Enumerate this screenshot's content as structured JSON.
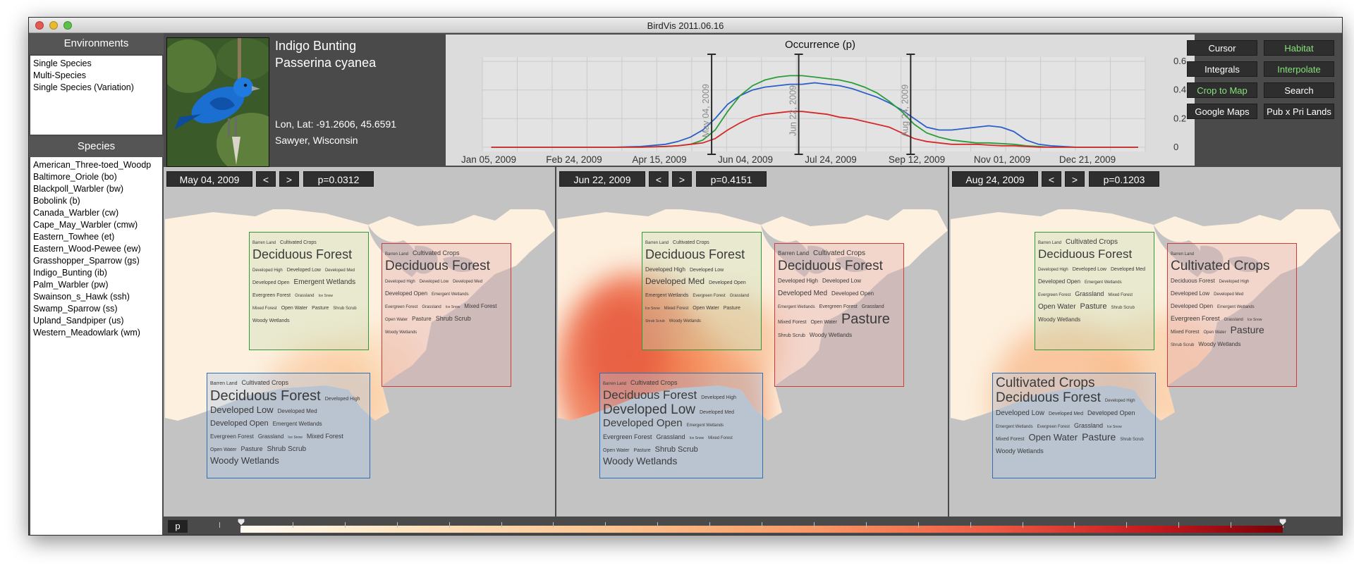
{
  "window": {
    "title": "BirdVis   2011.06.16"
  },
  "environments": {
    "header": "Environments",
    "items": [
      "Single Species",
      "Multi-Species",
      "Single Species (Variation)"
    ]
  },
  "species": {
    "header": "Species",
    "items": [
      "American_Three-toed_Woodp",
      "Baltimore_Oriole (bo)",
      "Blackpoll_Warbler (bw)",
      "Bobolink (b)",
      "Canada_Warbler (cw)",
      "Cape_May_Warbler (cmw)",
      "Eastern_Towhee (et)",
      "Eastern_Wood-Pewee (ew)",
      "Grasshopper_Sparrow (gs)",
      "Indigo_Bunting (ib)",
      "Palm_Warbler (pw)",
      "Swainson_s_Hawk (ssh)",
      "Swamp_Sparrow (ss)",
      "Upland_Sandpiper (us)",
      "Western_Meadowlark (wm)"
    ]
  },
  "bird": {
    "common_name": "Indigo Bunting",
    "latin_name": "Passerina cyanea",
    "lonlat": "Lon, Lat: -91.2606, 45.6591",
    "location": "Sawyer, Wisconsin"
  },
  "chart_data": {
    "type": "line",
    "title": "Occurrence (p)",
    "x_tick_labels": [
      "Jan 05, 2009",
      "Feb 24, 2009",
      "Apr 15, 2009",
      "Jun 04, 2009",
      "Jul 24, 2009",
      "Sep 12, 2009",
      "Nov 01, 2009",
      "Dec 21, 2009"
    ],
    "y_ticks": [
      0,
      0.2,
      0.4,
      0.6
    ],
    "y_tick_labels": [
      "0",
      "0.2",
      "0.4",
      "0.6"
    ],
    "ylim": [
      -0.03,
      0.63
    ],
    "x_day_range": [
      -5,
      368
    ],
    "x": [
      0,
      14,
      28,
      42,
      56,
      70,
      84,
      98,
      105,
      112,
      119,
      126,
      133,
      140,
      147,
      154,
      161,
      168,
      175,
      182,
      189,
      196,
      203,
      210,
      217,
      224,
      231,
      238,
      245,
      252,
      259,
      266,
      273,
      280,
      287,
      294,
      301,
      308,
      315,
      322,
      329,
      336,
      350,
      364
    ],
    "series": [
      {
        "color": "#2b5fc7",
        "values": [
          0,
          0,
          0,
          0,
          0,
          0,
          0.005,
          0.02,
          0.04,
          0.07,
          0.12,
          0.2,
          0.3,
          0.36,
          0.4,
          0.42,
          0.43,
          0.44,
          0.44,
          0.45,
          0.44,
          0.43,
          0.41,
          0.38,
          0.35,
          0.31,
          0.26,
          0.2,
          0.14,
          0.12,
          0.12,
          0.13,
          0.14,
          0.15,
          0.14,
          0.11,
          0.05,
          0.02,
          0.01,
          0.005,
          0,
          0,
          0,
          0
        ]
      },
      {
        "color": "#2a9d3a",
        "values": [
          0,
          0,
          0,
          0,
          0,
          0,
          0,
          0.005,
          0.01,
          0.02,
          0.05,
          0.12,
          0.25,
          0.36,
          0.43,
          0.47,
          0.49,
          0.5,
          0.5,
          0.49,
          0.48,
          0.47,
          0.45,
          0.42,
          0.38,
          0.32,
          0.25,
          0.16,
          0.1,
          0.07,
          0.05,
          0.04,
          0.03,
          0.03,
          0.025,
          0.02,
          0.01,
          0.005,
          0,
          0,
          0,
          0,
          0,
          0
        ]
      },
      {
        "color": "#d42a2a",
        "values": [
          0,
          0,
          0,
          0,
          0,
          0,
          0,
          0.005,
          0.01,
          0.02,
          0.03,
          0.06,
          0.12,
          0.17,
          0.21,
          0.23,
          0.24,
          0.25,
          0.25,
          0.24,
          0.23,
          0.21,
          0.2,
          0.18,
          0.16,
          0.14,
          0.1,
          0.06,
          0.04,
          0.03,
          0.02,
          0.02,
          0.02,
          0.015,
          0.01,
          0.01,
          0.005,
          0,
          0,
          0,
          0,
          0,
          0,
          0
        ]
      }
    ],
    "cursors": [
      {
        "label": "May 04, 2009",
        "day": 124
      },
      {
        "label": "Jun 22, 2009",
        "day": 173
      },
      {
        "label": "Aug 24, 2009",
        "day": 236
      }
    ]
  },
  "buttons": [
    {
      "label": "Cursor",
      "green": false
    },
    {
      "label": "Habitat",
      "green": true
    },
    {
      "label": "Integrals",
      "green": false
    },
    {
      "label": "Interpolate",
      "green": true
    },
    {
      "label": "Crop to Map",
      "green": true
    },
    {
      "label": "Search",
      "green": false
    },
    {
      "label": "Google Maps",
      "green": false
    },
    {
      "label": "Pub x Pri Lands",
      "green": false
    }
  ],
  "maps": [
    {
      "date": "May 04, 2009",
      "prev": "<",
      "next": ">",
      "p": "p=0.0312",
      "hotspots": [
        {
          "x": 230,
          "y": 290,
          "rx": 90,
          "ry": 100,
          "c": "#f8b37a",
          "o": 0.45
        },
        {
          "x": 300,
          "y": 230,
          "rx": 70,
          "ry": 60,
          "c": "#fbc693",
          "o": 0.35
        }
      ],
      "regions": [
        {
          "color": "green",
          "words": [
            [
              "Barren Land",
              6
            ],
            [
              "Cultivated Crops",
              7
            ],
            [
              "Deciduous Forest",
              18
            ],
            [
              "Developed High",
              6
            ],
            [
              "Developed Low",
              7
            ],
            [
              "Developed Med",
              6
            ],
            [
              "Developed Open",
              7
            ],
            [
              "Emergent Wetlands",
              10
            ],
            [
              "Evergreen Forest",
              7
            ],
            [
              "Grassland",
              6
            ],
            [
              "Ice Snow",
              5
            ],
            [
              "Mixed Forest",
              6
            ],
            [
              "Open Water",
              7
            ],
            [
              "Pasture",
              7
            ],
            [
              "Shrub Scrub",
              6
            ],
            [
              "Woody Wetlands",
              7
            ]
          ]
        },
        {
          "color": "red",
          "words": [
            [
              "Barren Land",
              6
            ],
            [
              "Cultivated Crops",
              9
            ],
            [
              "Deciduous Forest",
              19
            ],
            [
              "Developed High",
              6
            ],
            [
              "Developed Low",
              6
            ],
            [
              "Developed Med",
              6
            ],
            [
              "Developed Open",
              8
            ],
            [
              "Emergent Wetlands",
              6
            ],
            [
              "Evergreen Forest",
              6
            ],
            [
              "Grassland",
              6
            ],
            [
              "Ice Snow",
              5
            ],
            [
              "Mixed Forest",
              8
            ],
            [
              "Open Water",
              6
            ],
            [
              "Pasture",
              8
            ],
            [
              "Shrub Scrub",
              9
            ],
            [
              "Woody Wetlands",
              6
            ]
          ]
        },
        {
          "color": "blue",
          "words": [
            [
              "Barren Land",
              7
            ],
            [
              "Cultivated Crops",
              9
            ],
            [
              "Deciduous Forest",
              20
            ],
            [
              "Developed High",
              7
            ],
            [
              "Developed Low",
              13
            ],
            [
              "Developed Med",
              8
            ],
            [
              "Developed Open",
              11
            ],
            [
              "Emergent Wetlands",
              8
            ],
            [
              "Evergreen Forest",
              8
            ],
            [
              "Grassland",
              8
            ],
            [
              "Ice Snow",
              5
            ],
            [
              "Mixed Forest",
              9
            ],
            [
              "Open Water",
              7
            ],
            [
              "Pasture",
              9
            ],
            [
              "Shrub Scrub",
              10
            ],
            [
              "Woody Wetlands",
              13
            ]
          ]
        }
      ]
    },
    {
      "date": "Jun 22, 2009",
      "prev": "<",
      "next": ">",
      "p": "p=0.4151",
      "hotspots": [
        {
          "x": 110,
          "y": 230,
          "rx": 110,
          "ry": 140,
          "c": "#ee6a45",
          "o": 0.8
        },
        {
          "x": 190,
          "y": 290,
          "rx": 110,
          "ry": 110,
          "c": "#f3814f",
          "o": 0.65
        },
        {
          "x": 95,
          "y": 200,
          "rx": 60,
          "ry": 80,
          "c": "#e2472f",
          "o": 0.55
        },
        {
          "x": 250,
          "y": 190,
          "rx": 70,
          "ry": 70,
          "c": "#f6a36c",
          "o": 0.5
        },
        {
          "x": 190,
          "y": 350,
          "rx": 80,
          "ry": 50,
          "c": "#f8b37d",
          "o": 0.5
        }
      ],
      "regions": [
        {
          "color": "green",
          "words": [
            [
              "Barren Land",
              6
            ],
            [
              "Cultivated Crops",
              7
            ],
            [
              "Deciduous Forest",
              18
            ],
            [
              "Developed High",
              8
            ],
            [
              "Developed Low",
              7
            ],
            [
              "Developed Med",
              12
            ],
            [
              "Developed Open",
              7
            ],
            [
              "Emergent Wetlands",
              7
            ],
            [
              "Evergreen Forest",
              6
            ],
            [
              "Grassland",
              6
            ],
            [
              "Ice Snow",
              5
            ],
            [
              "Mixed Forest",
              6
            ],
            [
              "Open Water",
              7
            ],
            [
              "Pasture",
              7
            ],
            [
              "Shrub Scrub",
              5
            ],
            [
              "Woody Wetlands",
              6
            ]
          ]
        },
        {
          "color": "red",
          "words": [
            [
              "Barren Land",
              8
            ],
            [
              "Cultivated Crops",
              10
            ],
            [
              "Deciduous Forest",
              19
            ],
            [
              "Developed High",
              8
            ],
            [
              "Developed Low",
              8
            ],
            [
              "Developed Med",
              10
            ],
            [
              "Developed Open",
              8
            ],
            [
              "Emergent Wetlands",
              6
            ],
            [
              "Evergreen Forest",
              7
            ],
            [
              "Grassland",
              7
            ],
            [
              "Mixed Forest",
              7
            ],
            [
              "Open Water",
              7
            ],
            [
              "Pasture",
              20
            ],
            [
              "Shrub Scrub",
              7
            ],
            [
              "Woody Wetlands",
              8
            ]
          ]
        },
        {
          "color": "blue",
          "words": [
            [
              "Barren Land",
              6
            ],
            [
              "Cultivated Crops",
              9
            ],
            [
              "Deciduous Forest",
              17
            ],
            [
              "Developed High",
              7
            ],
            [
              "Developed Low",
              19
            ],
            [
              "Developed Med",
              7
            ],
            [
              "Developed Open",
              15
            ],
            [
              "Emergent Wetlands",
              6
            ],
            [
              "Evergreen Forest",
              9
            ],
            [
              "Grassland",
              9
            ],
            [
              "Ice Snow",
              5
            ],
            [
              "Mixed Forest",
              6
            ],
            [
              "Open Water",
              7
            ],
            [
              "Pasture",
              7
            ],
            [
              "Shrub Scrub",
              11
            ],
            [
              "Woody Wetlands",
              14
            ]
          ]
        }
      ]
    },
    {
      "date": "Aug 24, 2009",
      "prev": "<",
      "next": ">",
      "p": "p=0.1203",
      "hotspots": [
        {
          "x": 170,
          "y": 270,
          "rx": 110,
          "ry": 110,
          "c": "#f6a46c",
          "o": 0.55
        },
        {
          "x": 300,
          "y": 230,
          "rx": 90,
          "ry": 80,
          "c": "#f9b882",
          "o": 0.45
        },
        {
          "x": 380,
          "y": 280,
          "rx": 60,
          "ry": 60,
          "c": "#fbc693",
          "o": 0.35
        }
      ],
      "regions": [
        {
          "color": "green",
          "words": [
            [
              "Barren Land",
              6
            ],
            [
              "Cultivated Crops",
              10
            ],
            [
              "Deciduous Forest",
              17
            ],
            [
              "Developed High",
              6
            ],
            [
              "Developed Low",
              7
            ],
            [
              "Developed Med",
              7
            ],
            [
              "Developed Open",
              8
            ],
            [
              "Emergent Wetlands",
              6
            ],
            [
              "Evergreen Forest",
              6
            ],
            [
              "Grassland",
              9
            ],
            [
              "Mixed Forest",
              6
            ],
            [
              "Open Water",
              10
            ],
            [
              "Pasture",
              11
            ],
            [
              "Shrub Scrub",
              6
            ],
            [
              "Woody Wetlands",
              8
            ]
          ]
        },
        {
          "color": "red",
          "words": [
            [
              "Barren Land",
              6
            ],
            [
              "Cultivated Crops",
              19
            ],
            [
              "Deciduous Forest",
              8
            ],
            [
              "Developed High",
              6
            ],
            [
              "Developed Low",
              8
            ],
            [
              "Developed Med",
              6
            ],
            [
              "Developed Open",
              8
            ],
            [
              "Emergent Wetlands",
              6
            ],
            [
              "Evergreen Forest",
              9
            ],
            [
              "Grassland",
              6
            ],
            [
              "Ice Snow",
              5
            ],
            [
              "Mixed Forest",
              7
            ],
            [
              "Open Water",
              6
            ],
            [
              "Pasture",
              14
            ],
            [
              "Shrub Scrub",
              6
            ],
            [
              "Woody Wetlands",
              8
            ]
          ]
        },
        {
          "color": "blue",
          "words": [
            [
              "Cultivated Crops",
              19
            ],
            [
              "Deciduous Forest",
              19
            ],
            [
              "Developed High",
              6
            ],
            [
              "Developed Low",
              10
            ],
            [
              "Developed Med",
              7
            ],
            [
              "Developed Open",
              9
            ],
            [
              "Emergent Wetlands",
              6
            ],
            [
              "Evergreen Forest",
              6
            ],
            [
              "Grassland",
              9
            ],
            [
              "Ice Snow",
              5
            ],
            [
              "Mixed Forest",
              7
            ],
            [
              "Open Water",
              13
            ],
            [
              "Pasture",
              14
            ],
            [
              "Shrub Scrub",
              6
            ],
            [
              "Woody Wetlands",
              9
            ]
          ]
        }
      ]
    }
  ],
  "colorbar": {
    "label": "p",
    "ticks": [
      "-0.05",
      "0",
      "0.05",
      "0.1",
      "0.15",
      "0.2",
      "0.25",
      "0.3",
      "0.35",
      "0.4",
      "0.45",
      "0.5",
      "0.55",
      "0.6",
      "0.65",
      "0.7",
      "0.75",
      "0.8",
      "0.85",
      "0.9",
      "0.95",
      "1",
      "1.0"
    ]
  }
}
